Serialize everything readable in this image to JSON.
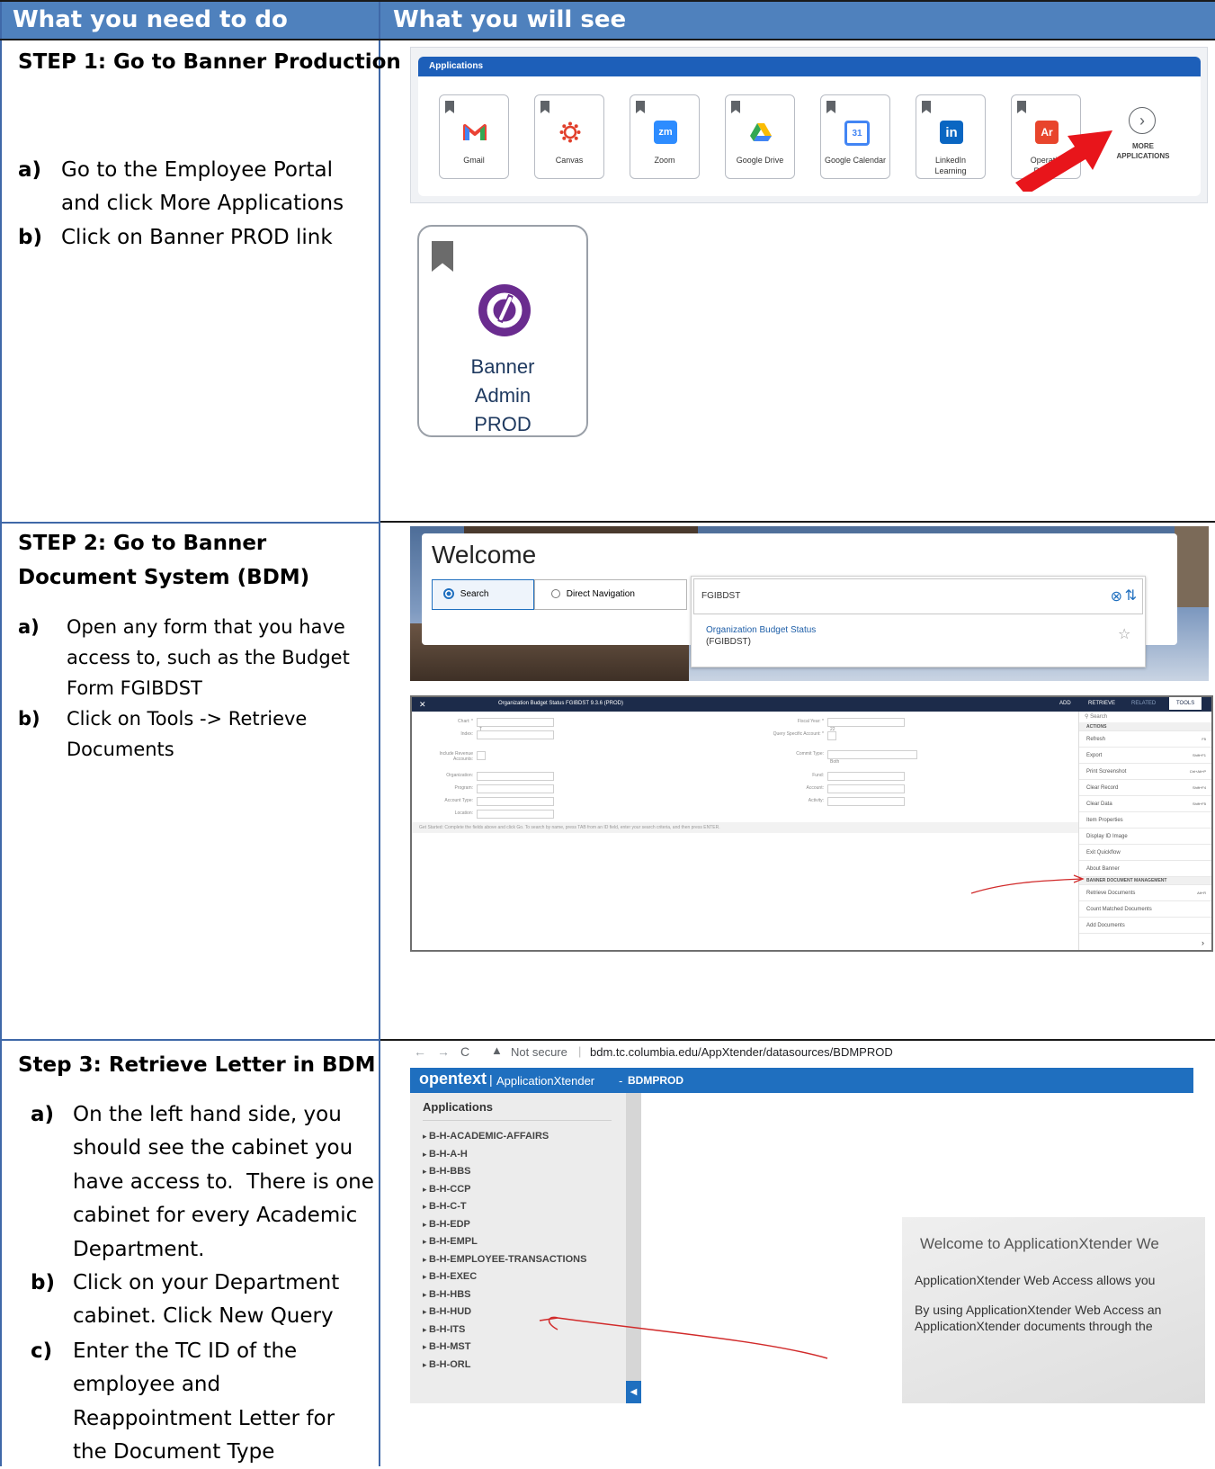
{
  "table": {
    "col1_header": "What you need to do",
    "col2_header": "What you will see"
  },
  "step1": {
    "title": "STEP 1: Go to Banner Production",
    "items": [
      {
        "letter": "a)",
        "lines": [
          "Go to the Employee Portal",
          "and click More Applications"
        ]
      },
      {
        "letter": "b)",
        "lines": [
          "Click on Banner PROD link"
        ]
      }
    ],
    "screenshot": {
      "bar_title": "Applications",
      "apps": [
        {
          "label": "Gmail",
          "icon": "gmail-icon",
          "color": "#ffffff"
        },
        {
          "label": "Canvas",
          "icon": "canvas-icon",
          "color": "#ffffff"
        },
        {
          "label": "Zoom",
          "icon": "zoom-icon",
          "glyph": "zm",
          "color": "#2d8cff"
        },
        {
          "label": "Google Drive",
          "icon": "google-drive-icon",
          "color": "#ffffff"
        },
        {
          "label": "Google Calendar",
          "icon": "google-calendar-icon",
          "glyph": "31",
          "color": "#4285f4"
        },
        {
          "label": "LinkedIn Learning",
          "icon": "linkedin-icon",
          "glyph": "in",
          "color": "#0a66c2"
        },
        {
          "label": "Operatio Report",
          "icon": "operations-report-icon",
          "glyph": "Ar",
          "color": "#e8452c"
        }
      ],
      "more_label": "MORE APPLICATIONS",
      "banner_tile_label": "Banner Admin PROD"
    }
  },
  "step2": {
    "title": "STEP 2: Go to Banner Document System (BDM)",
    "items": [
      {
        "letter": "a)",
        "lines": [
          "Open any form that you have",
          "access to, such as the Budget",
          "Form FGIBDST"
        ]
      },
      {
        "letter": "b)",
        "lines": [
          "Click on Tools -> Retrieve",
          "Documents"
        ]
      }
    ],
    "screenshot": {
      "welcome": "Welcome",
      "search_tab": "Search",
      "direct_tab": "Direct Navigation",
      "search_value": "FGIBDST",
      "result_title": "Organization Budget Status",
      "result_code": "(FGIBDST)",
      "form_title": "Organization Budget Status FGIBDST 9.3.6 (PROD)",
      "toolbar": [
        "ADD",
        "RETRIEVE",
        "RELATED",
        "TOOLS"
      ],
      "fields_left": [
        "Chart: *",
        "Index:",
        "Include Revenue Accounts:",
        "Organization:",
        "Program:",
        "Account Type:",
        "Location:"
      ],
      "fields_right": [
        "Fiscal Year: *",
        "Query Specific Account: *",
        "Commit Type:",
        "Fund:",
        "Account:",
        "Activity:"
      ],
      "commit_value": "Both",
      "chart_value": "T",
      "fiscal_value": "22",
      "hint": "Get Started: Complete the fields above and click Go. To search by name, press TAB from an ID field, enter your search criteria, and then press ENTER.",
      "tools_search": "Search",
      "actions_header": "ACTIONS",
      "actions": [
        {
          "label": "Refresh",
          "key": "F5"
        },
        {
          "label": "Export",
          "key": "Shift+F1"
        },
        {
          "label": "Print Screenshot",
          "key": "Ctrl+Alt+P"
        },
        {
          "label": "Clear Record",
          "key": "Shift+F4"
        },
        {
          "label": "Clear Data",
          "key": "Shift+F5"
        },
        {
          "label": "Item Properties",
          "key": ""
        },
        {
          "label": "Display ID Image",
          "key": ""
        },
        {
          "label": "Exit Quickflow",
          "key": ""
        },
        {
          "label": "About Banner",
          "key": ""
        }
      ],
      "bdm_header": "BANNER DOCUMENT MANAGEMENT",
      "bdm_actions": [
        {
          "label": "Retrieve Documents",
          "key": "Alt+R"
        },
        {
          "label": "Count Matched Documents",
          "key": ""
        },
        {
          "label": "Add Documents",
          "key": ""
        }
      ]
    }
  },
  "step3": {
    "title": "Step 3: Retrieve Letter in BDM",
    "items": [
      {
        "letter": "a)",
        "lines": [
          "On the left hand side, you",
          "should see the cabinet you",
          "have access to.  There is one",
          "cabinet for every Academic",
          "Department."
        ]
      },
      {
        "letter": "b)",
        "lines": [
          "Click on your Department",
          "cabinet. Click New Query"
        ]
      },
      {
        "letter": "c)",
        "lines": [
          "Enter the TC ID of the",
          "employee and",
          "Reappointment Letter for",
          "the Document Type"
        ]
      }
    ],
    "screenshot": {
      "not_secure": "Not secure",
      "url": "bdm.tc.columbia.edu/AppXtender/datasources/BDMPROD",
      "brand": "opentext",
      "app_name": "ApplicationXtender",
      "datasource": "BDMPROD",
      "apps_header": "Applications",
      "cabinets": [
        "B-H-ACADEMIC-AFFAIRS",
        "B-H-A-H",
        "B-H-BBS",
        "B-H-CCP",
        "B-H-C-T",
        "B-H-EDP",
        "B-H-EMPL",
        "B-H-EMPLOYEE-TRANSACTIONS",
        "B-H-EXEC",
        "B-H-HBS",
        "B-H-HUD",
        "B-H-ITS",
        "B-H-MST",
        "B-H-ORL"
      ],
      "welcome_title": "Welcome to ApplicationXtender We",
      "welcome_line1": "ApplicationXtender Web Access allows you",
      "welcome_line2": "By using ApplicationXtender Web Access an",
      "welcome_line3": "ApplicationXtender documents through the"
    }
  }
}
